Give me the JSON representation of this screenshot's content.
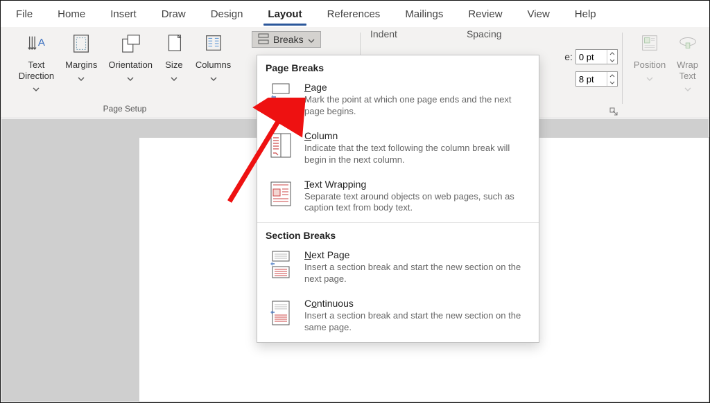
{
  "menu": {
    "tabs": [
      "File",
      "Home",
      "Insert",
      "Draw",
      "Design",
      "Layout",
      "References",
      "Mailings",
      "Review",
      "View",
      "Help"
    ],
    "active": "Layout"
  },
  "ribbon": {
    "page_setup": {
      "text_direction": "Text\nDirection",
      "margins": "Margins",
      "orientation": "Orientation",
      "size": "Size",
      "columns": "Columns",
      "group_label": "Page Setup"
    },
    "breaks_button": "Breaks",
    "paragraph": {
      "indent_label": "Indent",
      "spacing_label": "Spacing",
      "before_suffix": "e:",
      "before_value": "0 pt",
      "after_value": "8 pt"
    },
    "arrange": {
      "position": "Position",
      "wrap_text": "Wrap\nText"
    }
  },
  "dropdown": {
    "page_breaks": "Page Breaks",
    "section_breaks": "Section Breaks",
    "items": [
      {
        "title": "Page",
        "underline_first": true,
        "desc": "Mark the point at which one page ends and the next page begins."
      },
      {
        "title": "Column",
        "underline_first": true,
        "desc": "Indicate that the text following the column break will begin in the next column."
      },
      {
        "title": "Text Wrapping",
        "underline_first": true,
        "desc": "Separate text around objects on web pages, such as caption text from body text."
      },
      {
        "title": "Next Page",
        "underline_first": true,
        "desc": "Insert a section break and start the new section on the next page."
      },
      {
        "title": "Continuous",
        "underline_first": true,
        "desc": "Insert a section break and start the new section on the same page."
      }
    ]
  }
}
